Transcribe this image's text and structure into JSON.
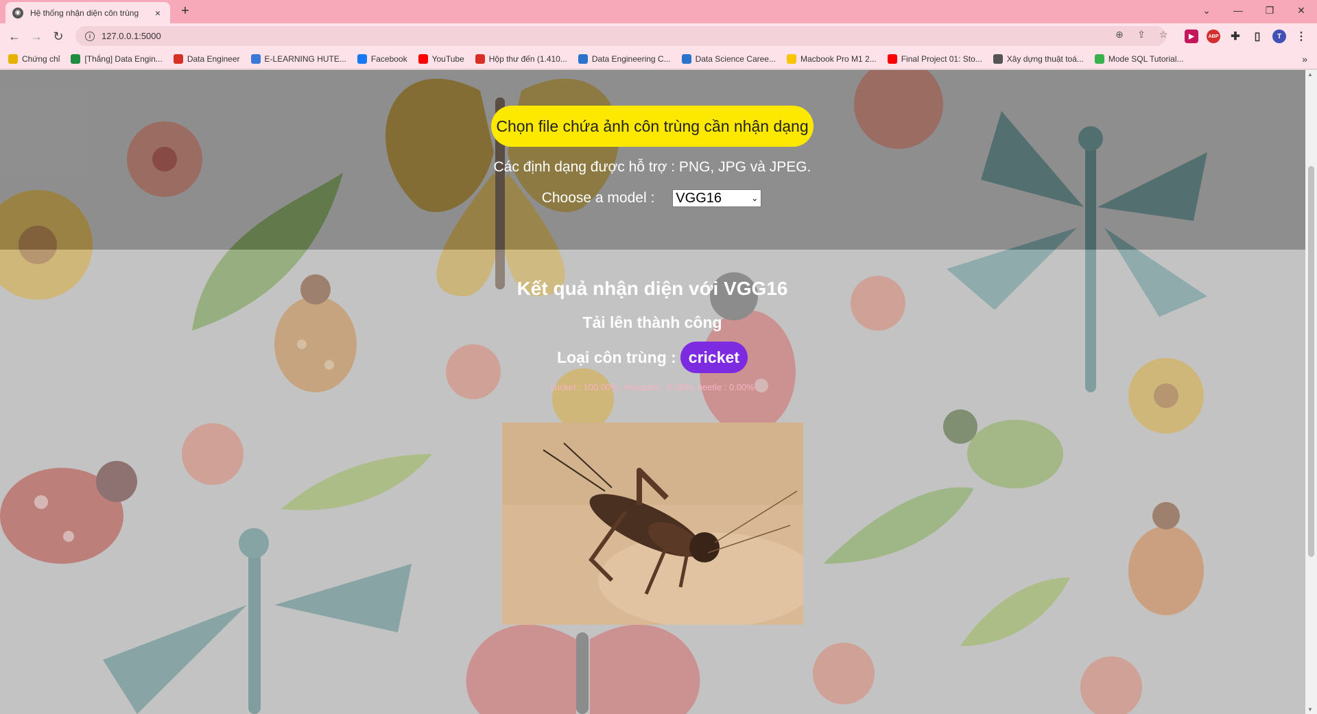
{
  "browser": {
    "tab_title": "Hệ thống nhận diện côn trùng",
    "tab_close": "×",
    "new_tab": "+",
    "url": "127.0.0.1:5000",
    "bookmarks": [
      {
        "label": "Chứng chỉ",
        "icon": "folder-icon",
        "color": "#e8b100"
      },
      {
        "label": "[Thắng] Data Engin...",
        "icon": "sheets-icon",
        "color": "#1e8e3e"
      },
      {
        "label": "Data Engineer",
        "icon": "brush-icon",
        "color": "#d93025"
      },
      {
        "label": "E-LEARNING HUTE...",
        "icon": "hute-icon",
        "color": "#3c78d8"
      },
      {
        "label": "Facebook",
        "icon": "facebook-icon",
        "color": "#1877f2"
      },
      {
        "label": "YouTube",
        "icon": "youtube-icon",
        "color": "#ff0000"
      },
      {
        "label": "Hộp thư đến (1.410...",
        "icon": "gmail-icon",
        "color": "#d93025"
      },
      {
        "label": "Data Engineering C...",
        "icon": "coursera-icon",
        "color": "#2a73cc"
      },
      {
        "label": "Data Science Caree...",
        "icon": "coursera-icon",
        "color": "#2a73cc"
      },
      {
        "label": "Macbook Pro M1 2...",
        "icon": "star-icon",
        "color": "#f9c400"
      },
      {
        "label": "Final Project 01: Sto...",
        "icon": "youtube-icon",
        "color": "#ff0000"
      },
      {
        "label": "Xây dựng thuật toá...",
        "icon": "image-icon",
        "color": "#555555"
      },
      {
        "label": "Mode SQL Tutorial...",
        "icon": "mode-icon",
        "color": "#37b24d"
      }
    ],
    "bookmarks_more": "»",
    "profile_initial": "T"
  },
  "page": {
    "upload_button": "Chọn file chứa ảnh côn trùng cần nhận dạng",
    "formats_text": "Các định dạng được hỗ trợ : PNG, JPG và JPEG.",
    "model_label": "Choose a model :",
    "model_selected": "VGG16",
    "result_title": "Kết quả nhận diện với VGG16",
    "upload_status": "Tải lên thành công",
    "class_label": "Loại côn trùng :",
    "class_value": "cricket",
    "probabilities": "cricket : 100.00%, mosquito : 0.00%, beetle : 0.00%"
  },
  "colors": {
    "upload_button": "#fde800",
    "class_badge": "#7d2be0",
    "probabilities_text": "#f7b3c3",
    "tabbar": "#f7a9b9",
    "toolbar": "#fde3e9"
  }
}
